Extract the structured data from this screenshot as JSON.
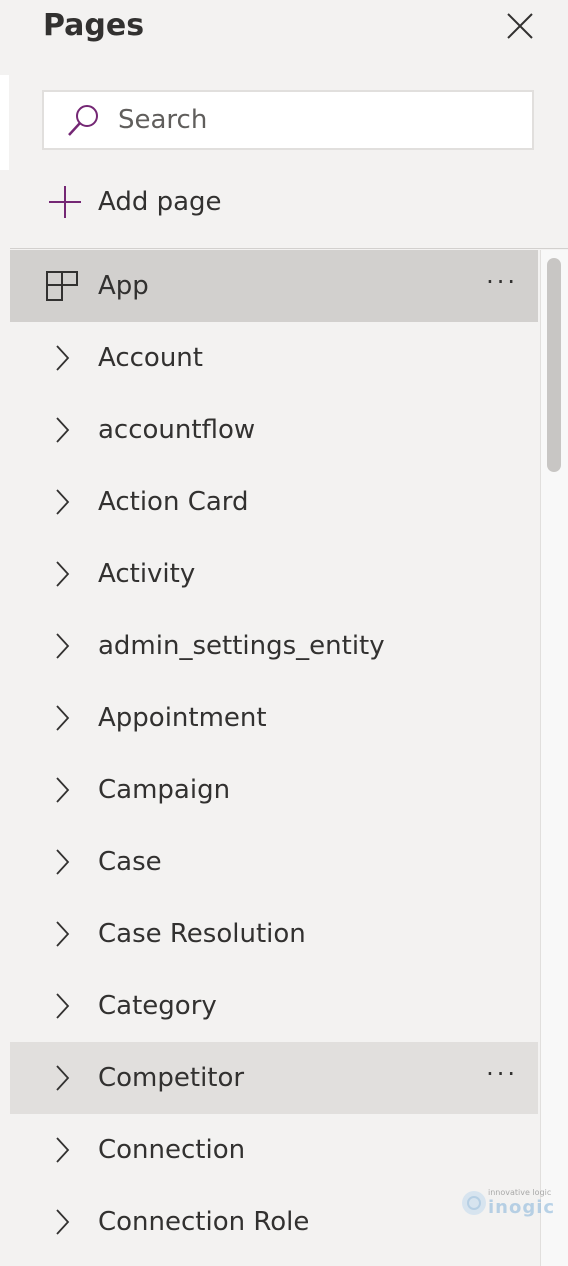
{
  "panel": {
    "title": "Pages",
    "close_icon": "close-icon",
    "search": {
      "placeholder": "Search",
      "value": "",
      "icon": "search-icon"
    },
    "add_page": {
      "label": "Add page",
      "icon": "plus-icon"
    }
  },
  "items": [
    {
      "label": "App",
      "icon": "app-layout-icon",
      "state": "selected",
      "more": "···"
    },
    {
      "label": "Account",
      "icon": "chevron-right-icon"
    },
    {
      "label": "accountflow",
      "icon": "chevron-right-icon"
    },
    {
      "label": "Action Card",
      "icon": "chevron-right-icon"
    },
    {
      "label": "Activity",
      "icon": "chevron-right-icon"
    },
    {
      "label": "admin_settings_entity",
      "icon": "chevron-right-icon"
    },
    {
      "label": "Appointment",
      "icon": "chevron-right-icon"
    },
    {
      "label": "Campaign",
      "icon": "chevron-right-icon"
    },
    {
      "label": "Case",
      "icon": "chevron-right-icon"
    },
    {
      "label": "Case Resolution",
      "icon": "chevron-right-icon"
    },
    {
      "label": "Category",
      "icon": "chevron-right-icon"
    },
    {
      "label": "Competitor",
      "icon": "chevron-right-icon",
      "state": "hover",
      "more": "···"
    },
    {
      "label": "Connection",
      "icon": "chevron-right-icon"
    },
    {
      "label": "Connection Role",
      "icon": "chevron-right-icon"
    }
  ],
  "watermark": {
    "tagline": "innovative logic",
    "brand": "inogic"
  },
  "colors": {
    "accent": "#742774",
    "selected_bg": "#d2d0ce",
    "hover_bg": "#e1dfdd",
    "panel_bg": "#f3f2f1"
  }
}
